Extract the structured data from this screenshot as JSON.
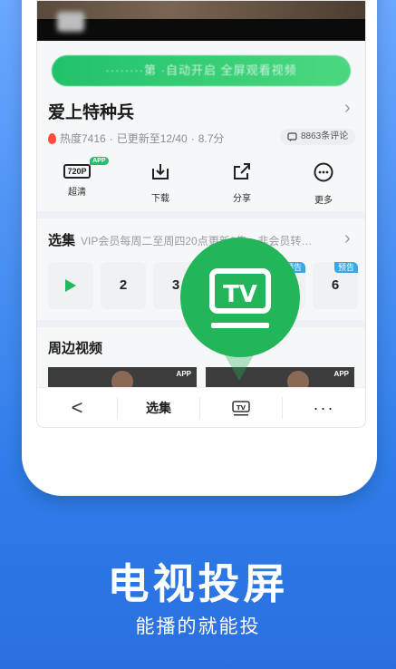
{
  "banner": {
    "text": "········第 ·自动开启 全屏观看视频"
  },
  "show": {
    "title": "爱上特种兵",
    "heat": "热度7416",
    "update": "已更新至12/40",
    "rating": "8.7分",
    "comments": "8863条评论"
  },
  "actions": [
    {
      "label": "超清",
      "icon": "hd-720p-icon",
      "badge_text": "720P",
      "app_badge": "APP"
    },
    {
      "label": "下载",
      "icon": "download-icon"
    },
    {
      "label": "分享",
      "icon": "share-icon"
    },
    {
      "label": "更多",
      "icon": "more-circle-icon"
    }
  ],
  "episodes": {
    "title": "选集",
    "desc": "VIP会员每周二至周四20点更新2集，非会员转…",
    "items": [
      "",
      "2",
      "3",
      "",
      "",
      "6"
    ],
    "preview_tag": "预告"
  },
  "related": {
    "title": "周边视频",
    "app_tag": "APP"
  },
  "bottom_bar": {
    "back": "<",
    "episodes": "选集",
    "cast_icon_text": "TV",
    "more": "···"
  },
  "cast_bubble": {
    "text": "TV"
  },
  "promo": {
    "headline": "电视投屏",
    "subline": "能播的就能投"
  },
  "colors": {
    "accent_green": "#23b559",
    "background_blue": "#2f7de9"
  }
}
